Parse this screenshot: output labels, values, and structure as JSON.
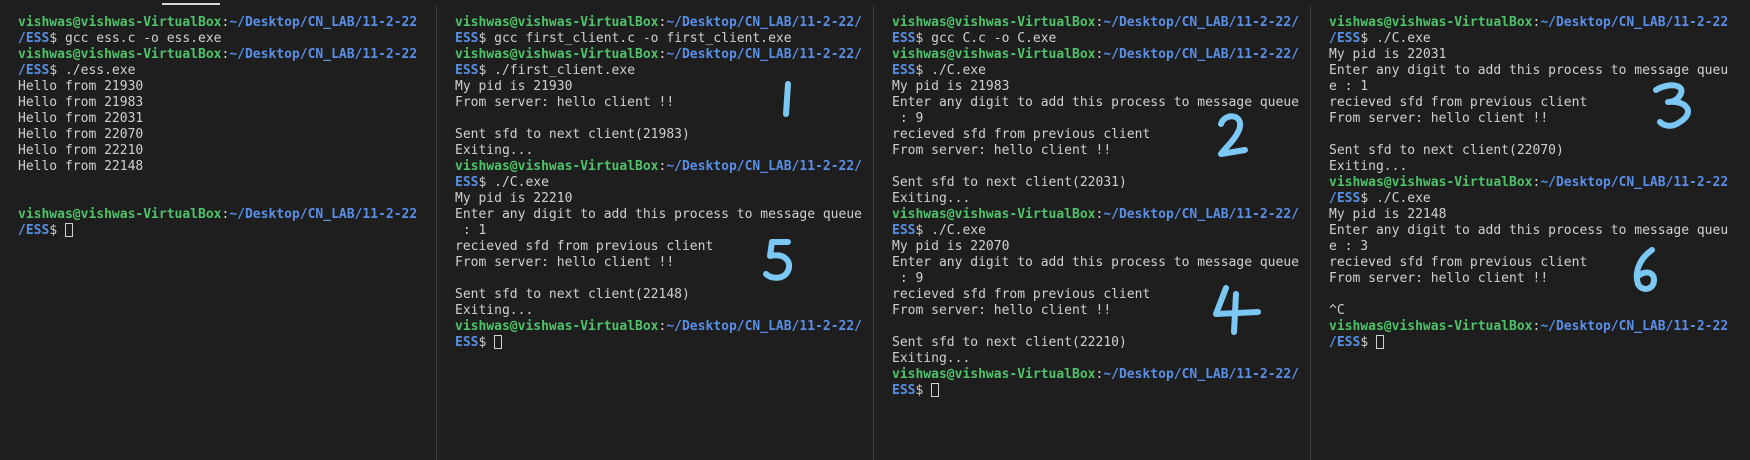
{
  "accent_colors": {
    "user": "#4ec36a",
    "path": "#5a8fe6",
    "annotation": "#7cc8f4",
    "background": "#1e1e1e"
  },
  "prompt": {
    "user": "vishwas@vishwas-VirtualBox",
    "colon": ":",
    "path_a": "~/Desktop/CN_LAB/11-2-22",
    "path_b": "/ESS",
    "path_a2": "~/Desktop/CN_LAB/11-2-22/",
    "path_b2": "ESS",
    "dollar": "$"
  },
  "panes": [
    {
      "lines": [
        {
          "prompt": true,
          "split": 1,
          "cmd": ""
        },
        {
          "prompt": false,
          "text": "/ESS$ gcc ess.c -o ess.exe",
          "lead": "/ESS",
          "rest": "$ gcc ess.c -o ess.exe"
        },
        {
          "prompt": true,
          "split": 1,
          "cmd": ""
        },
        {
          "prompt": false,
          "lead": "/ESS",
          "rest": "$ ./ess.exe"
        },
        {
          "text": "Hello from 21930"
        },
        {
          "text": "Hello from 21983"
        },
        {
          "text": "Hello from 22031"
        },
        {
          "text": "Hello from 22070"
        },
        {
          "text": "Hello from 22210"
        },
        {
          "text": "Hello from 22148"
        },
        {
          "text": ""
        },
        {
          "text": ""
        },
        {
          "prompt": true,
          "split": 1,
          "cmd": ""
        },
        {
          "prompt": false,
          "lead": "/ESS",
          "rest": "$ ",
          "cursor": true
        }
      ]
    },
    {
      "lines": [
        {
          "prompt": true,
          "split": 2,
          "cmd": ""
        },
        {
          "prompt": false,
          "lead": "ESS",
          "rest": "$ gcc first_client.c -o first_client.exe"
        },
        {
          "prompt": true,
          "split": 2,
          "cmd": ""
        },
        {
          "prompt": false,
          "lead": "ESS",
          "rest": "$ ./first_client.exe"
        },
        {
          "text": "My pid is 21930"
        },
        {
          "text": "From server: hello client !!"
        },
        {
          "text": ""
        },
        {
          "text": "Sent sfd to next client(21983)"
        },
        {
          "text": "Exiting..."
        },
        {
          "prompt": true,
          "split": 2,
          "cmd": ""
        },
        {
          "prompt": false,
          "lead": "ESS",
          "rest": "$ ./C.exe"
        },
        {
          "text": "My pid is 22210"
        },
        {
          "text": "Enter any digit to add this process to message queue"
        },
        {
          "text": " : 1"
        },
        {
          "text": "recieved sfd from previous client"
        },
        {
          "text": "From server: hello client !!"
        },
        {
          "text": ""
        },
        {
          "text": "Sent sfd to next client(22148)"
        },
        {
          "text": "Exiting..."
        },
        {
          "prompt": true,
          "split": 2,
          "cmd": ""
        },
        {
          "prompt": false,
          "lead": "ESS",
          "rest": "$ ",
          "cursor": true
        }
      ]
    },
    {
      "lines": [
        {
          "prompt": true,
          "split": 2,
          "cmd": ""
        },
        {
          "prompt": false,
          "lead": "ESS",
          "rest": "$ gcc C.c -o C.exe"
        },
        {
          "prompt": true,
          "split": 2,
          "cmd": ""
        },
        {
          "prompt": false,
          "lead": "ESS",
          "rest": "$ ./C.exe"
        },
        {
          "text": "My pid is 21983"
        },
        {
          "text": "Enter any digit to add this process to message queue"
        },
        {
          "text": " : 9"
        },
        {
          "text": "recieved sfd from previous client"
        },
        {
          "text": "From server: hello client !!"
        },
        {
          "text": ""
        },
        {
          "text": "Sent sfd to next client(22031)"
        },
        {
          "text": "Exiting..."
        },
        {
          "prompt": true,
          "split": 2,
          "cmd": ""
        },
        {
          "prompt": false,
          "lead": "ESS",
          "rest": "$ ./C.exe"
        },
        {
          "text": "My pid is 22070"
        },
        {
          "text": "Enter any digit to add this process to message queue"
        },
        {
          "text": " : 9"
        },
        {
          "text": "recieved sfd from previous client"
        },
        {
          "text": "From server: hello client !!"
        },
        {
          "text": ""
        },
        {
          "text": "Sent sfd to next client(22210)"
        },
        {
          "text": "Exiting..."
        },
        {
          "prompt": true,
          "split": 2,
          "cmd": ""
        },
        {
          "prompt": false,
          "lead": "ESS",
          "rest": "$ ",
          "cursor": true
        }
      ]
    },
    {
      "lines": [
        {
          "prompt": true,
          "split": 1,
          "cmd": ""
        },
        {
          "prompt": false,
          "lead": "/ESS",
          "rest": "$ ./C.exe"
        },
        {
          "text": "My pid is 22031"
        },
        {
          "text": "Enter any digit to add this process to message queu"
        },
        {
          "text": "e : 1"
        },
        {
          "text": "recieved sfd from previous client"
        },
        {
          "text": "From server: hello client !!"
        },
        {
          "text": ""
        },
        {
          "text": "Sent sfd to next client(22070)"
        },
        {
          "text": "Exiting..."
        },
        {
          "prompt": true,
          "split": 1,
          "cmd": ""
        },
        {
          "prompt": false,
          "lead": "/ESS",
          "rest": "$ ./C.exe"
        },
        {
          "text": "My pid is 22148"
        },
        {
          "text": "Enter any digit to add this process to message queu"
        },
        {
          "text": "e : 3"
        },
        {
          "text": "recieved sfd from previous client"
        },
        {
          "text": "From server: hello client !!"
        },
        {
          "text": ""
        },
        {
          "text": "^C"
        },
        {
          "prompt": true,
          "split": 1,
          "cmd": ""
        },
        {
          "prompt": false,
          "lead": "/ESS",
          "rest": "$ ",
          "cursor": true
        }
      ]
    }
  ],
  "annotations": [
    "1",
    "2",
    "3",
    "4",
    "5",
    "6"
  ]
}
